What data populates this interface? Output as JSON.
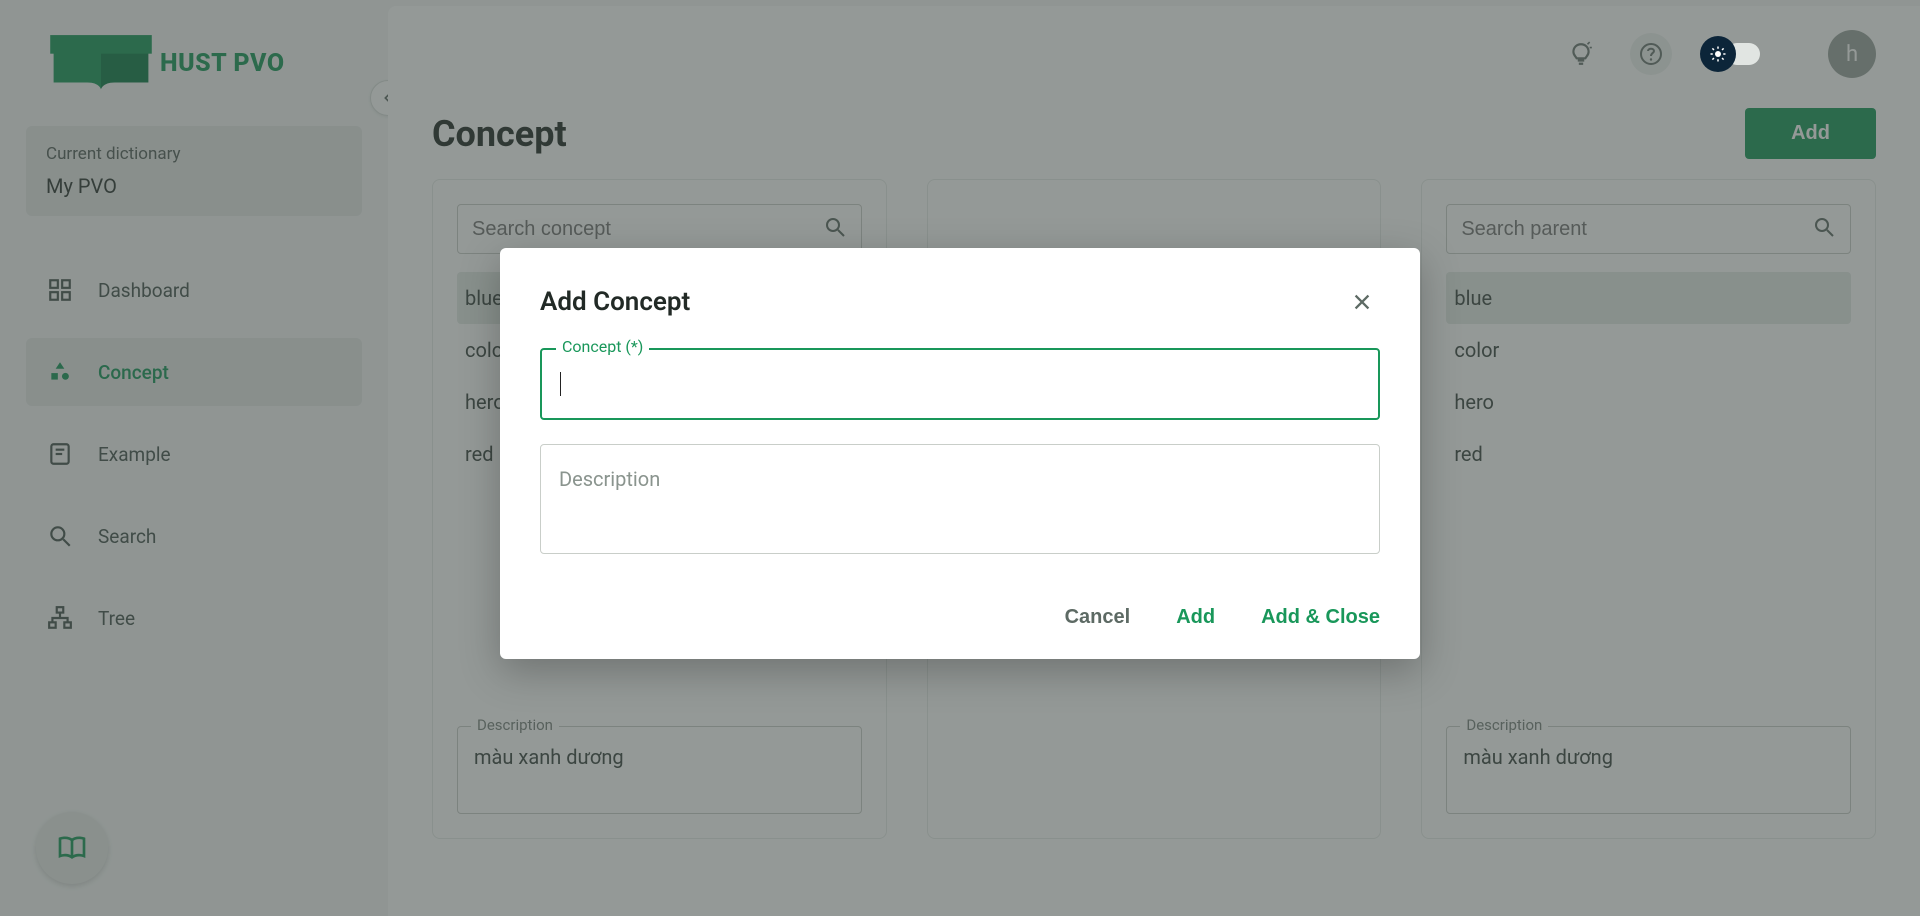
{
  "brand": {
    "name": "HUST PVO"
  },
  "dictionary": {
    "label": "Current dictionary",
    "value": "My PVO"
  },
  "nav": {
    "dashboard": "Dashboard",
    "concept": "Concept",
    "example": "Example",
    "search": "Search",
    "tree": "Tree"
  },
  "avatar": {
    "initial": "h"
  },
  "page": {
    "title": "Concept",
    "add_button": "Add"
  },
  "columns": {
    "left": {
      "search_placeholder": "Search concept",
      "items": [
        "blue",
        "color",
        "hero",
        "red"
      ],
      "desc_label": "Description",
      "desc_value": "màu xanh dương"
    },
    "right": {
      "search_placeholder": "Search parent",
      "items": [
        "blue",
        "color",
        "hero",
        "red"
      ],
      "desc_label": "Description",
      "desc_value": "màu xanh dương"
    }
  },
  "modal": {
    "title": "Add Concept",
    "concept_label": "Concept (*)",
    "desc_placeholder": "Description",
    "cancel": "Cancel",
    "add": "Add",
    "add_close": "Add & Close"
  }
}
